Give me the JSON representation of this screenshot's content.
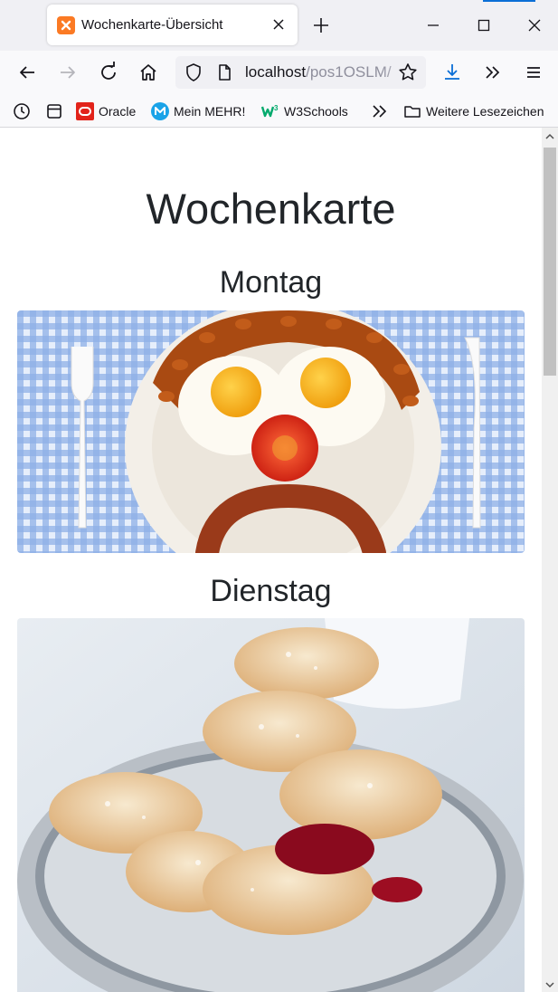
{
  "browser": {
    "tab_title": "Wochenkarte-Übersicht",
    "url_host": "localhost",
    "url_path": "/pos1OSLM/"
  },
  "bookmarks": [
    {
      "label": "Oracle",
      "icon": "oracle-icon"
    },
    {
      "label": "Mein MEHR!",
      "icon": "mehr-icon"
    },
    {
      "label": "W3Schools",
      "icon": "w3schools-icon"
    },
    {
      "label": "Weitere Lesezeichen",
      "icon": "folder-icon"
    }
  ],
  "page": {
    "title": "Wochenkarte",
    "days": [
      {
        "label": "Montag",
        "image": "breakfast-face-photo"
      },
      {
        "label": "Dienstag",
        "image": "pancakes-photo"
      }
    ]
  },
  "colors": {
    "tabbar_bg": "#f0f0f4",
    "toolbar_bg": "#f9f9fb",
    "accent": "#0b6fd6",
    "text": "#212529"
  }
}
